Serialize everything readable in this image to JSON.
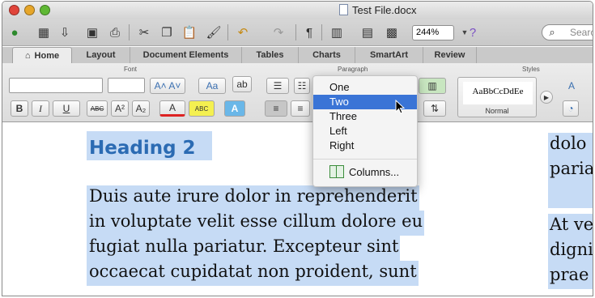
{
  "window": {
    "title": "Test File.docx"
  },
  "toolbar": {
    "zoom": "244%",
    "search_placeholder": "Searc"
  },
  "tabs": [
    "Home",
    "Layout",
    "Document Elements",
    "Tables",
    "Charts",
    "SmartArt",
    "Review"
  ],
  "ribbon": {
    "groups": {
      "font": "Font",
      "paragraph": "Paragraph",
      "styles": "Styles"
    },
    "font_buttons": {
      "bold": "B",
      "italic": "I",
      "underline": "U",
      "strike": "ABC",
      "superscript": "A²",
      "subscript": "A₂",
      "font_color": "A",
      "highlight": "ABC"
    },
    "style_preview": "AaBbCcDdEe",
    "style_name": "Normal"
  },
  "columns_menu": {
    "items": [
      "One",
      "Two",
      "Three",
      "Left",
      "Right"
    ],
    "selected": "Two",
    "columns_label": "Columns..."
  },
  "document": {
    "heading": "Heading 2",
    "lines": [
      "Duis aute irure dolor in reprehenderit",
      "in voluptate velit esse cillum dolore eu",
      "fugiat nulla pariatur. Excepteur sint",
      "occaecat cupidatat non proident, sunt"
    ],
    "right_lines": [
      "dolo",
      "paria",
      "",
      "At ve",
      "digni",
      "prae"
    ]
  },
  "colors": {
    "accent": "#3a74d6",
    "heading": "#2b6bb3",
    "highlight": "#c6dbf5"
  }
}
